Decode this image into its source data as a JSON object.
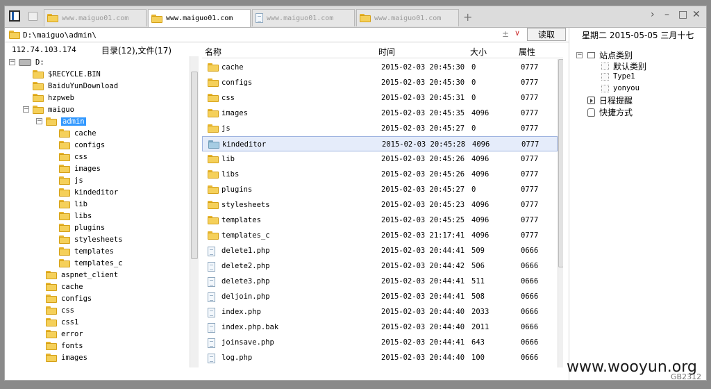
{
  "tabs": [
    {
      "label": "www.maiguo01.com",
      "active": false
    },
    {
      "label": "www.maiguo01.com",
      "active": true
    },
    {
      "label": "www.maiguo01.com",
      "active": false
    },
    {
      "label": "www.maiguo01.com",
      "active": false
    }
  ],
  "address": {
    "path": "D:\\maiguo\\admin\\",
    "read_button": "读取"
  },
  "info": {
    "ip": "112.74.103.174",
    "counts": "目录(12),文件(17)"
  },
  "tree": {
    "drive": "D:",
    "items": [
      {
        "label": "$RECYCLE.BIN"
      },
      {
        "label": "BaiduYunDownload"
      },
      {
        "label": "hzpweb"
      },
      {
        "label": "maiguo"
      },
      {
        "label": "admin"
      },
      {
        "label": "cache"
      },
      {
        "label": "configs"
      },
      {
        "label": "css"
      },
      {
        "label": "images"
      },
      {
        "label": "js"
      },
      {
        "label": "kindeditor"
      },
      {
        "label": "lib"
      },
      {
        "label": "libs"
      },
      {
        "label": "plugins"
      },
      {
        "label": "stylesheets"
      },
      {
        "label": "templates"
      },
      {
        "label": "templates_c"
      },
      {
        "label": "aspnet_client"
      },
      {
        "label": "cache"
      },
      {
        "label": "configs"
      },
      {
        "label": "css"
      },
      {
        "label": "css1"
      },
      {
        "label": "error"
      },
      {
        "label": "fonts"
      },
      {
        "label": "images"
      }
    ]
  },
  "list": {
    "headers": {
      "name": "名称",
      "time": "时间",
      "size": "大小",
      "attr": "属性"
    },
    "rows": [
      {
        "name": "cache",
        "time": "2015-02-03 20:45:30",
        "size": "0",
        "attr": "0777"
      },
      {
        "name": "configs",
        "time": "2015-02-03 20:45:30",
        "size": "0",
        "attr": "0777"
      },
      {
        "name": "css",
        "time": "2015-02-03 20:45:31",
        "size": "0",
        "attr": "0777"
      },
      {
        "name": "images",
        "time": "2015-02-03 20:45:35",
        "size": "4096",
        "attr": "0777"
      },
      {
        "name": "js",
        "time": "2015-02-03 20:45:27",
        "size": "0",
        "attr": "0777"
      },
      {
        "name": "kindeditor",
        "time": "2015-02-03 20:45:28",
        "size": "4096",
        "attr": "0777"
      },
      {
        "name": "lib",
        "time": "2015-02-03 20:45:26",
        "size": "4096",
        "attr": "0777"
      },
      {
        "name": "libs",
        "time": "2015-02-03 20:45:26",
        "size": "4096",
        "attr": "0777"
      },
      {
        "name": "plugins",
        "time": "2015-02-03 20:45:27",
        "size": "0",
        "attr": "0777"
      },
      {
        "name": "stylesheets",
        "time": "2015-02-03 20:45:23",
        "size": "4096",
        "attr": "0777"
      },
      {
        "name": "templates",
        "time": "2015-02-03 20:45:25",
        "size": "4096",
        "attr": "0777"
      },
      {
        "name": "templates_c",
        "time": "2015-02-03 21:17:41",
        "size": "4096",
        "attr": "0777"
      },
      {
        "name": "delete1.php",
        "time": "2015-02-03 20:44:41",
        "size": "509",
        "attr": "0666"
      },
      {
        "name": "delete2.php",
        "time": "2015-02-03 20:44:42",
        "size": "506",
        "attr": "0666"
      },
      {
        "name": "delete3.php",
        "time": "2015-02-03 20:44:41",
        "size": "511",
        "attr": "0666"
      },
      {
        "name": "deljoin.php",
        "time": "2015-02-03 20:44:41",
        "size": "508",
        "attr": "0666"
      },
      {
        "name": "index.php",
        "time": "2015-02-03 20:44:40",
        "size": "2033",
        "attr": "0666"
      },
      {
        "name": "index.php.bak",
        "time": "2015-02-03 20:44:40",
        "size": "2011",
        "attr": "0666"
      },
      {
        "name": "joinsave.php",
        "time": "2015-02-03 20:44:41",
        "size": "643",
        "attr": "0666"
      },
      {
        "name": "log.php",
        "time": "2015-02-03 20:44:40",
        "size": "100",
        "attr": "0666"
      }
    ]
  },
  "right": {
    "date": "星期二 2015-05-05 三月十七",
    "site_category": "站点类别",
    "categories": [
      "默认类别",
      "Type1",
      "yonyou"
    ],
    "reminder": "日程提醒",
    "shortcut": "快捷方式"
  },
  "watermark": "www.wooyun.org",
  "corner_code": "GB2312"
}
